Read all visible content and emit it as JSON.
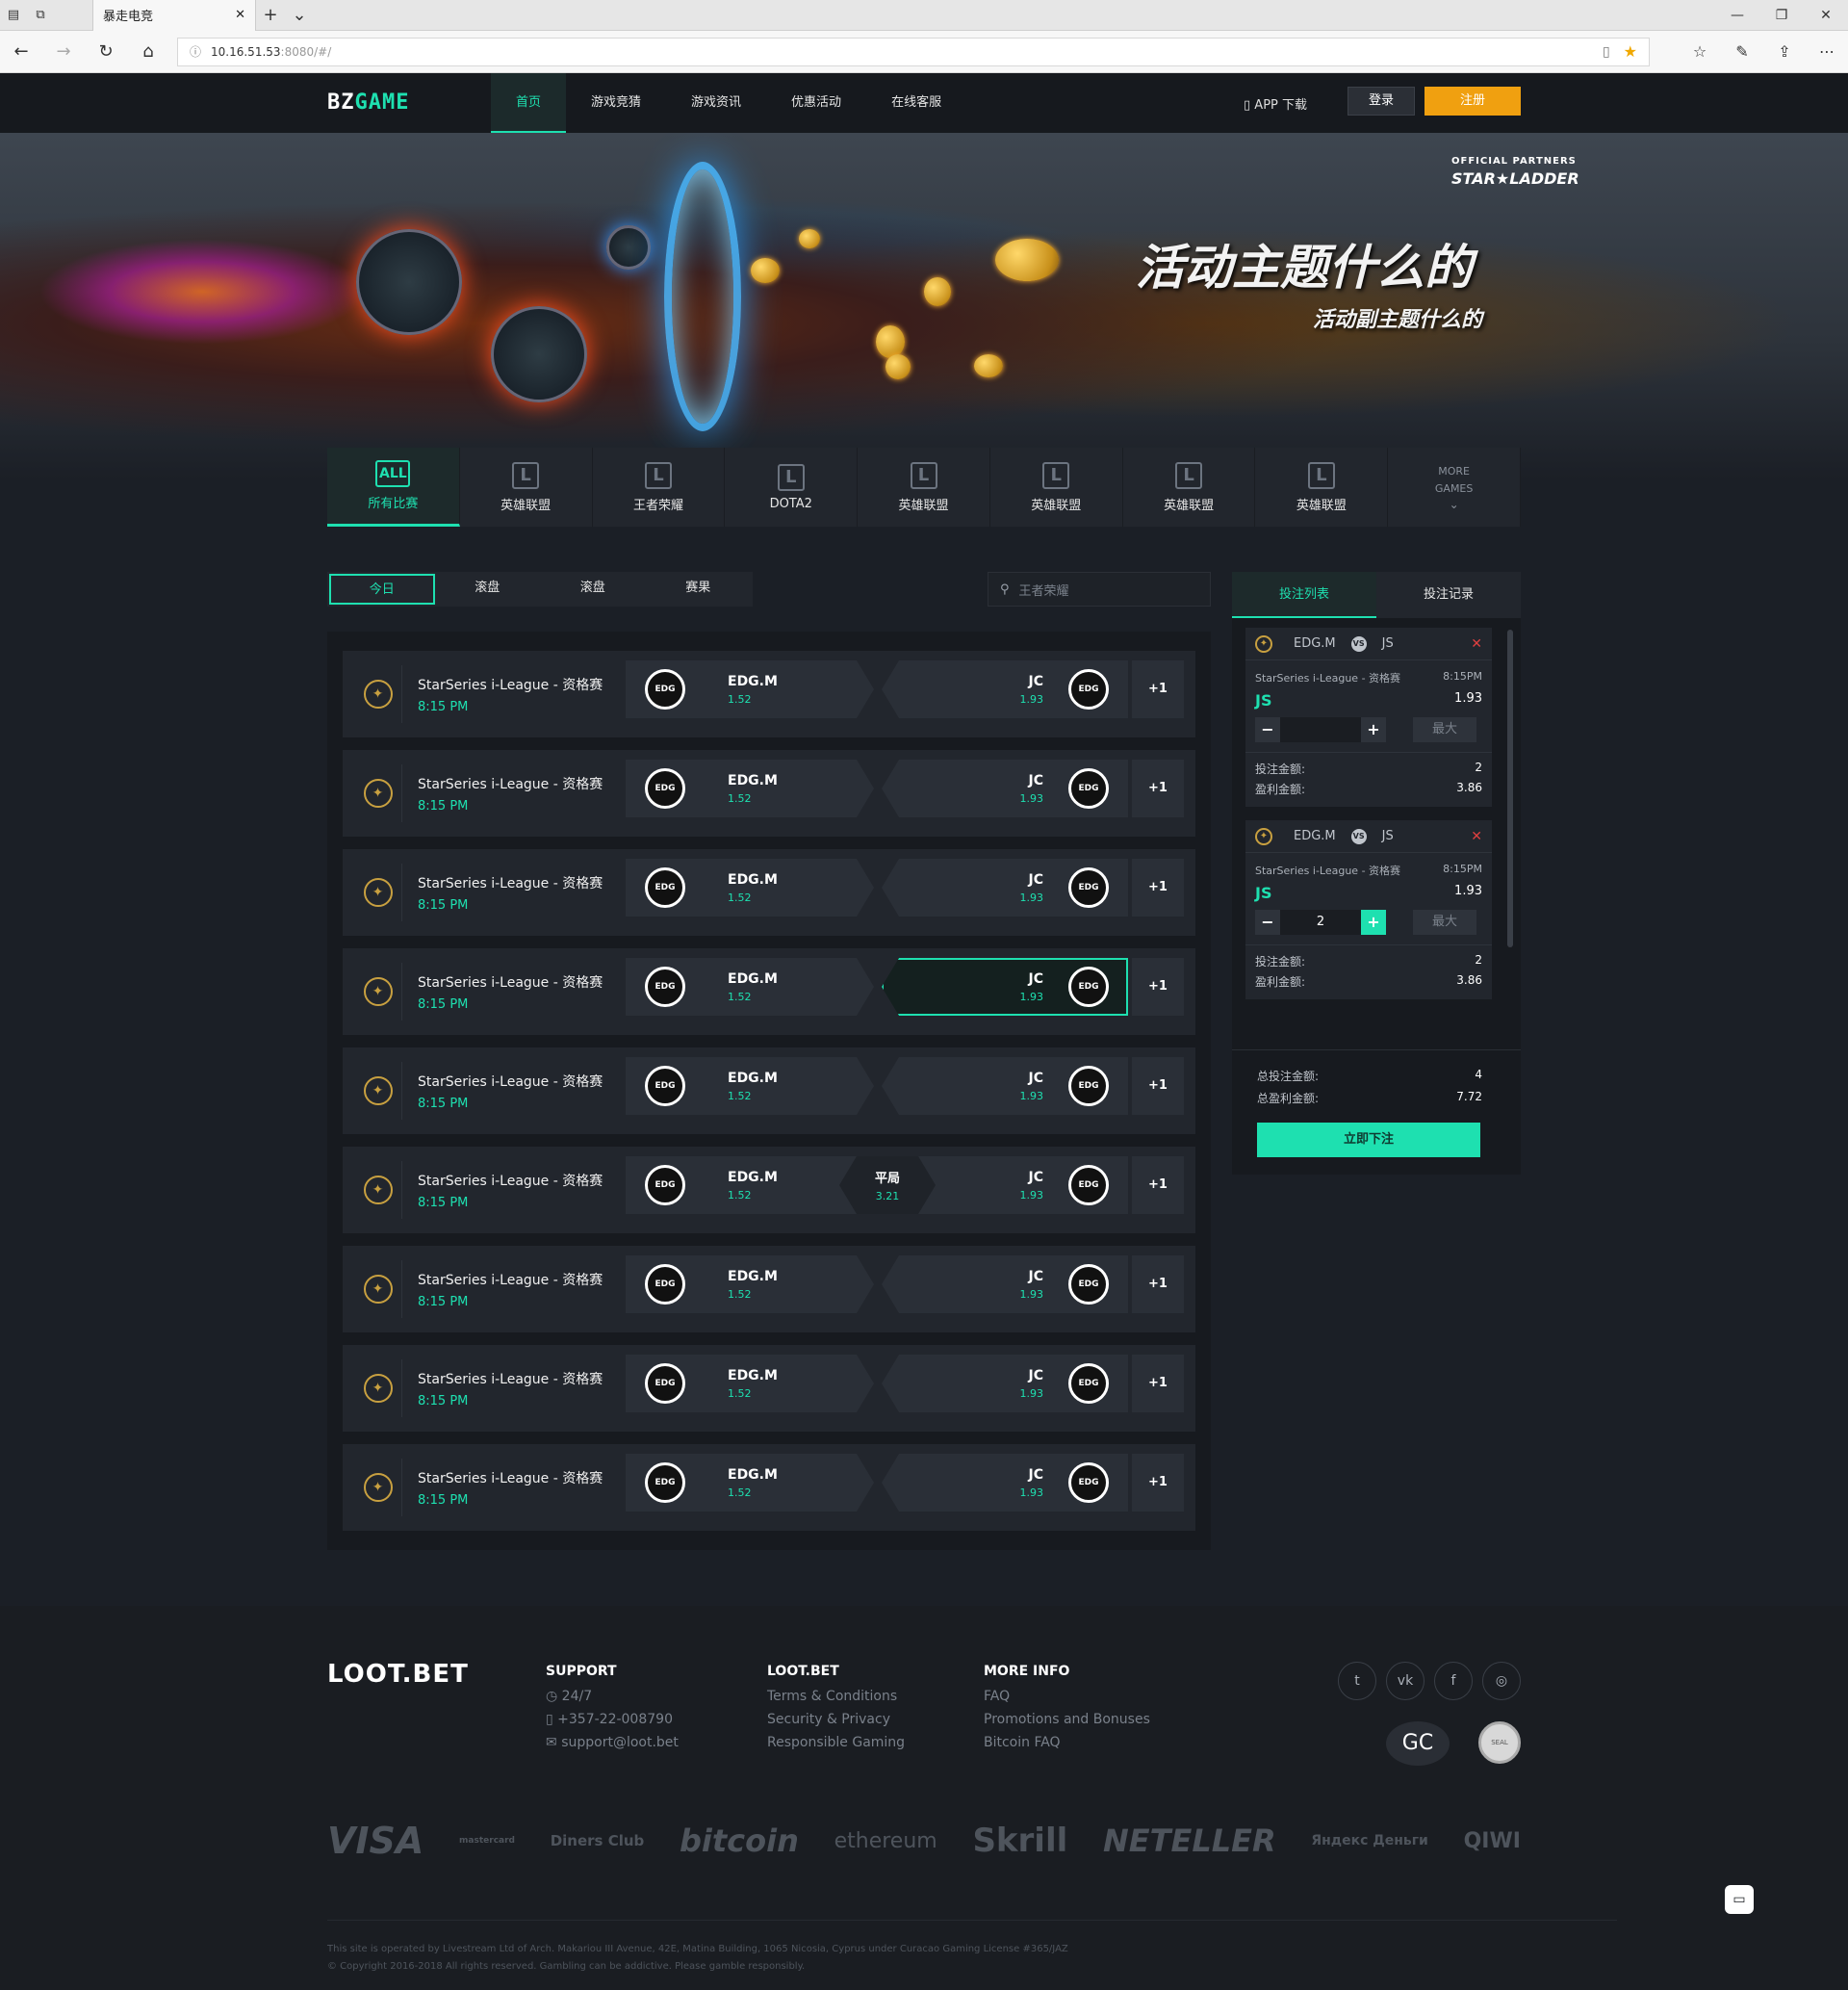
{
  "browser": {
    "tab_title": "暴走电竞",
    "url_host": "10.16.51.53",
    "url_rest": ":8080/#/"
  },
  "header": {
    "logo_a": "BZ",
    "logo_b": "GAME",
    "nav": [
      "首页",
      "游戏竞猜",
      "游戏资讯",
      "优惠活动",
      "在线客服"
    ],
    "app": "APP 下载",
    "login": "登录",
    "register": "注册"
  },
  "banner": {
    "partner_label": "OFFICIAL PARTNERS",
    "partner": "STAR★LADDER",
    "title": "活动主题什么的",
    "subtitle": "活动副主题什么的"
  },
  "game_tabs": [
    {
      "icon": "ALL",
      "label": "所有比赛"
    },
    {
      "icon": "L",
      "label": "英雄联盟"
    },
    {
      "icon": "L",
      "label": "王者荣耀"
    },
    {
      "icon": "L",
      "label": "DOTA2"
    },
    {
      "icon": "L",
      "label": "英雄联盟"
    },
    {
      "icon": "L",
      "label": "英雄联盟"
    },
    {
      "icon": "L",
      "label": "英雄联盟"
    },
    {
      "icon": "L",
      "label": "英雄联盟"
    }
  ],
  "more_games": "MORE GAMES",
  "filters": [
    "今日",
    "滚盘",
    "滚盘",
    "赛果"
  ],
  "search_placeholder": "王者荣耀",
  "matches": [
    {
      "league": "StarSeries i-League - 资格赛",
      "time": "8:15 PM",
      "team1": "EDG.M",
      "odds1": "1.52",
      "team2": "JC",
      "odds2": "1.93",
      "more": "+1"
    },
    {
      "league": "StarSeries i-League - 资格赛",
      "time": "8:15 PM",
      "team1": "EDG.M",
      "odds1": "1.52",
      "team2": "JC",
      "odds2": "1.93",
      "more": "+1"
    },
    {
      "league": "StarSeries i-League - 资格赛",
      "time": "8:15 PM",
      "team1": "EDG.M",
      "odds1": "1.52",
      "team2": "JC",
      "odds2": "1.93",
      "more": "+1"
    },
    {
      "league": "StarSeries i-League - 资格赛",
      "time": "8:15 PM",
      "team1": "EDG.M",
      "odds1": "1.52",
      "team2": "JC",
      "odds2": "1.93",
      "more": "+1"
    },
    {
      "league": "StarSeries i-League - 资格赛",
      "time": "8:15 PM",
      "team1": "EDG.M",
      "odds1": "1.52",
      "team2": "JC",
      "odds2": "1.93",
      "more": "+1"
    },
    {
      "league": "StarSeries i-League - 资格赛",
      "time": "8:15 PM",
      "team1": "EDG.M",
      "odds1": "1.52",
      "team2": "JC",
      "odds2": "1.93",
      "more": "+1",
      "draw": "平局",
      "draw_odds": "3.21"
    },
    {
      "league": "StarSeries i-League - 资格赛",
      "time": "8:15 PM",
      "team1": "EDG.M",
      "odds1": "1.52",
      "team2": "JC",
      "odds2": "1.93",
      "more": "+1"
    },
    {
      "league": "StarSeries i-League - 资格赛",
      "time": "8:15 PM",
      "team1": "EDG.M",
      "odds1": "1.52",
      "team2": "JC",
      "odds2": "1.93",
      "more": "+1"
    },
    {
      "league": "StarSeries i-League - 资格赛",
      "time": "8:15 PM",
      "team1": "EDG.M",
      "odds1": "1.52",
      "team2": "JC",
      "odds2": "1.93",
      "more": "+1"
    }
  ],
  "team_logo": "EDG",
  "slip": {
    "tabs": [
      "投注列表",
      "投注记录"
    ],
    "cards": [
      {
        "t1": "EDG.M",
        "vs": "VS",
        "t2": "JS",
        "league": "StarSeries i-League - 资格赛",
        "time": "8:15PM",
        "pick": "JS",
        "odds": "1.93",
        "amount": "",
        "max": "最大",
        "bet_label": "投注金额:",
        "bet": "2",
        "win_label": "盈利金额:",
        "win": "3.86"
      },
      {
        "t1": "EDG.M",
        "vs": "VS",
        "t2": "JS",
        "league": "StarSeries i-League - 资格赛",
        "time": "8:15PM",
        "pick": "JS",
        "odds": "1.93",
        "amount": "2",
        "max": "最大",
        "bet_label": "投注金额:",
        "bet": "2",
        "win_label": "盈利金额:",
        "win": "3.86"
      }
    ],
    "total_bet_label": "总投注金额:",
    "total_bet": "4",
    "total_win_label": "总盈利金额:",
    "total_win": "7.72",
    "place": "立即下注"
  },
  "footer": {
    "logo": "LOOT.BET",
    "support": {
      "title": "SUPPORT",
      "items": [
        "24/7",
        "+357-22-008790",
        "support@loot.bet"
      ]
    },
    "lootbet": {
      "title": "LOOT.BET",
      "items": [
        "Terms & Conditions",
        "Security & Privacy",
        "Responsible Gaming"
      ]
    },
    "more": {
      "title": "MORE INFO",
      "items": [
        "FAQ",
        "Promotions and Bonuses",
        "Bitcoin FAQ"
      ]
    },
    "gc": "GC",
    "payments": [
      "VISA",
      "mastercard",
      "Diners Club",
      "bitcoin",
      "ethereum",
      "Skrill",
      "NETELLER",
      "Яндекс Деньги",
      "QIWI"
    ],
    "legal1": "This site is operated by Livestream Ltd of Arch. Makariou III Avenue, 42E, Matina Building, 1065 Nicosia, Cyprus under Curacao Gaming License #365/JAZ",
    "legal2": "© Copyright 2016-2018 All rights reserved. Gambling can be addictive. Please gamble responsibly."
  }
}
